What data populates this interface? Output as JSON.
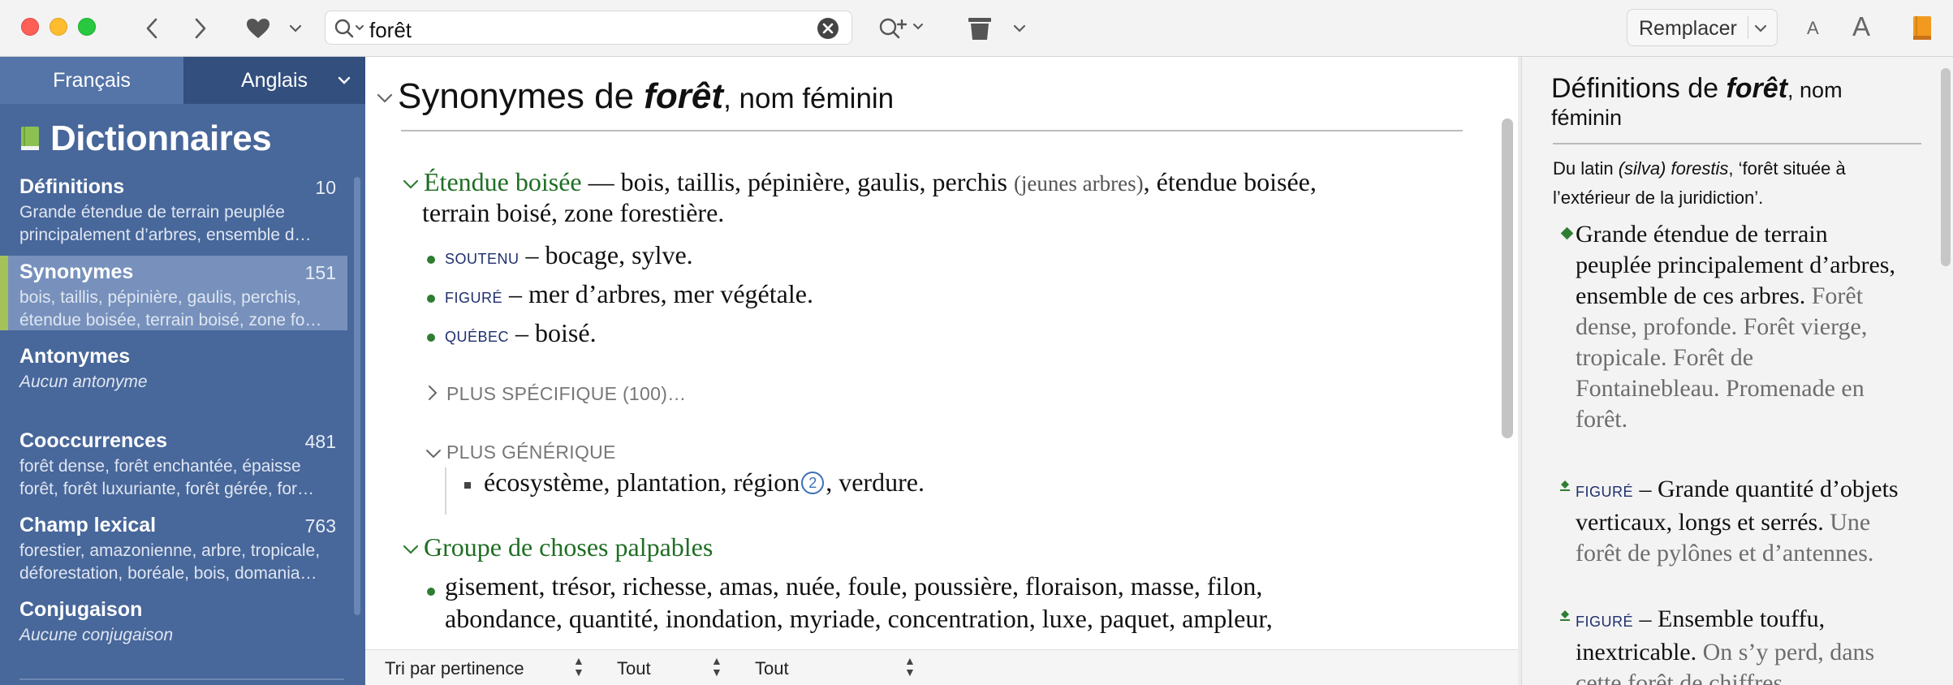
{
  "colors": {
    "accent_green": "#1f6e23",
    "sidebar_bg": "#48679a",
    "selected_bar": "#a3c25a"
  },
  "toolbar": {
    "search_value": "forêt",
    "replace_label": "Remplacer",
    "font_small": "A",
    "font_large": "A",
    "icons": [
      "back-icon",
      "forward-icon",
      "heart-icon",
      "search-icon",
      "clear-icon",
      "zoom-add-icon",
      "trash-icon",
      "book-icon"
    ]
  },
  "sidebar": {
    "tabs": {
      "french": "Français",
      "english": "Anglais"
    },
    "title": "Dictionnaires",
    "items": [
      {
        "title": "Définitions",
        "count": "10",
        "desc": "Grande étendue de terrain peuplée principalement d’arbres, ensemble d…"
      },
      {
        "title": "Synonymes",
        "count": "151",
        "desc": "bois, taillis, pépinière, gaulis, perchis, étendue boisée, terrain boisé, zone fo…"
      },
      {
        "title": "Antonymes",
        "count": "",
        "desc": "Aucun antonyme"
      },
      {
        "title": "Cooccurrences",
        "count": "481",
        "desc": "forêt dense, forêt enchantée, épaisse forêt, forêt luxuriante, forêt gérée, for…"
      },
      {
        "title": "Champ lexical",
        "count": "763",
        "desc": "forestier, amazonienne, arbre, tropicale, déforestation, boréale, bois, domania…"
      },
      {
        "title": "Conjugaison",
        "count": "",
        "desc": "Aucune conjugaison"
      }
    ]
  },
  "main": {
    "title_prefix": "Synonymes de ",
    "title_word": "forêt",
    "title_pos": ", nom féminin",
    "sense1": {
      "head": "Étendue boisée",
      "text_a": " — bois, taillis, pépinière, gaulis, perchis ",
      "note": "(jeunes arbres)",
      "text_b": ", étendue boisée,",
      "line2": "terrain boisé, zone forestière."
    },
    "registers": [
      {
        "label": "SOUTENU",
        "text": " – bocage, sylve."
      },
      {
        "label": "FIGURÉ",
        "text": " – mer d’arbres, mer végétale."
      },
      {
        "label": "QUÉBEC",
        "text": " – boisé."
      }
    ],
    "more_specific": "PLUS SPÉCIFIQUE (100)…",
    "more_generic": "PLUS GÉNÉRIQUE",
    "generic_a": "écosystème, plantation, région",
    "generic_num": "2",
    "generic_b": ", verdure.",
    "sense2": {
      "head": "Groupe de choses palpables",
      "line1": "gisement, trésor, richesse, amas, nuée, foule, poussière, floraison, masse, filon,",
      "line2": "abondance, quantité, inondation, myriade, concentration, luxe, paquet, ampleur,"
    },
    "bottom": {
      "sort": "Tri par pertinence",
      "filter1": "Tout",
      "filter2": "Tout"
    }
  },
  "definitions": {
    "title_prefix": "Définitions de ",
    "title_word": "forêt",
    "title_pos": ", nom",
    "title_pos2": "féminin",
    "etym_a": "Du latin ",
    "etym_italic": "(silva) forestis",
    "etym_b": ", ‘forêt située à l’extérieur de la juridiction’.",
    "def1": "Grande étendue de terrain peuplée principalement d’arbres, ensemble de ces arbres.",
    "def1_ex": " Forêt dense, profonde. Forêt vierge, tropicale. Forêt de Fontainebleau. Promenade en forêt.",
    "def2_label": "FIGURÉ",
    "def2": " – Grande quantité d’objets verticaux, longs et serrés.",
    "def2_ex": " Une forêt de pylônes et d’antennes.",
    "def3_label": "FIGURÉ",
    "def3": " – Ensemble touffu, inextricable.",
    "def3_ex": " On s’y perd, dans cette forêt de chiffres."
  }
}
